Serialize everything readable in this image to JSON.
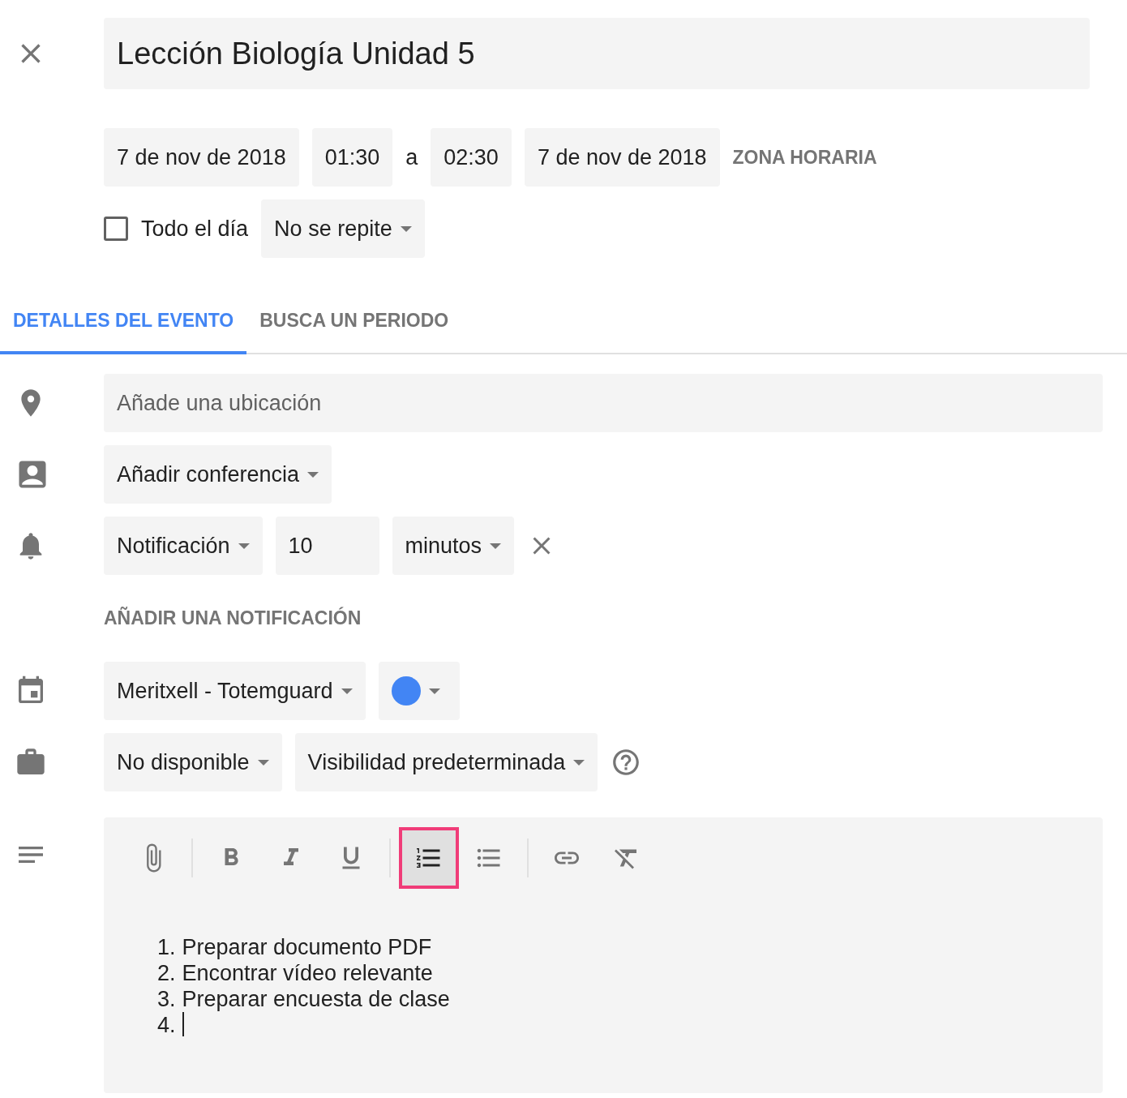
{
  "title": "Lección Biología Unidad 5",
  "dates": {
    "start_date": "7 de nov de 2018",
    "start_time": "01:30",
    "separator": "a",
    "end_time": "02:30",
    "end_date": "7 de nov de 2018",
    "timezone": "ZONA HORARIA"
  },
  "all_day": {
    "label": "Todo el día",
    "checked": false
  },
  "repeat": "No se repite",
  "tabs": [
    {
      "label": "DETALLES DEL EVENTO",
      "selected": true
    },
    {
      "label": "BUSCA UN PERIODO",
      "selected": false
    }
  ],
  "location": {
    "placeholder": "Añade una ubicación"
  },
  "conference": "Añadir conferencia",
  "notification": {
    "type": "Notificación",
    "amount": "10",
    "unit": "minutos"
  },
  "add_notification": "AÑADIR UNA NOTIFICACIÓN",
  "calendar": {
    "name": "Meritxell - Totemguard",
    "color": "#4285f4"
  },
  "availability": "No disponible",
  "visibility": "Visibilidad predeterminada",
  "toolbar": [
    [
      {
        "kind": "attach",
        "selected": false
      }
    ],
    [
      {
        "kind": "bold",
        "selected": false
      },
      {
        "kind": "italic",
        "selected": false
      },
      {
        "kind": "underline",
        "selected": false
      }
    ],
    [
      {
        "kind": "numbered",
        "selected": true
      },
      {
        "kind": "bulleted",
        "selected": false
      }
    ],
    [
      {
        "kind": "link",
        "selected": false
      },
      {
        "kind": "clear",
        "selected": false
      }
    ]
  ],
  "description": [
    {
      "number": "1.",
      "text": "Preparar documento PDF"
    },
    {
      "number": "2.",
      "text": "Encontrar vídeo relevante"
    },
    {
      "number": "3.",
      "text": "Preparar encuesta de clase"
    },
    {
      "number": "4.",
      "cursor": true
    }
  ]
}
